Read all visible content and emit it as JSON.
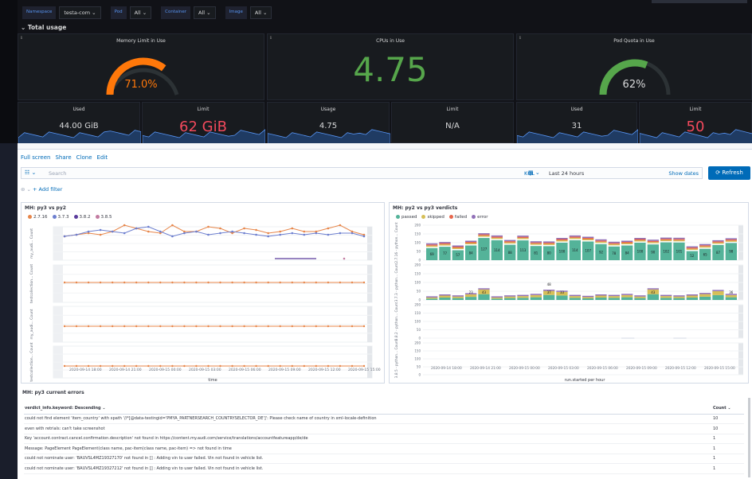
{
  "grafana": {
    "filters": [
      {
        "label": "Namespace",
        "value": "testa-com ⌄"
      },
      {
        "label": "Pod",
        "value": "All ⌄"
      },
      {
        "label": "Container",
        "value": "All ⌄"
      },
      {
        "label": "Image",
        "value": "All ⌄"
      }
    ],
    "row_title": "⌄ Total usage",
    "panels": {
      "memory": {
        "title": "Memory Limit in Use",
        "value": "71.0%",
        "fraction": 0.71,
        "color": "#ff780a"
      },
      "cpus": {
        "title": "CPUs in Use",
        "value": "4.75",
        "color": "#56a64b"
      },
      "pod_quota": {
        "title": "Pod Quota in Use",
        "value": "62%",
        "fraction": 0.62,
        "color": "#56a64b"
      }
    },
    "stats": [
      {
        "title": "Used",
        "value": "44.00 GiB",
        "color": "#d8d9da"
      },
      {
        "title": "Limit",
        "value": "62 GiB",
        "color": "#f2495c"
      },
      {
        "title": "Usage",
        "value": "4.75",
        "color": "#d8d9da"
      },
      {
        "title": "Limit",
        "value": "N/A",
        "color": "#d8d9da"
      },
      {
        "title": "Used",
        "value": "31",
        "color": "#d8d9da"
      },
      {
        "title": "Limit",
        "value": "50",
        "color": "#f2495c"
      }
    ]
  },
  "kibana": {
    "links": [
      "Full screen",
      "Share",
      "Clone",
      "Edit"
    ],
    "search": {
      "placeholder": "Search",
      "kql": "KQL",
      "time": "Last 24 hours",
      "show_dates": "Show dates",
      "refresh": "⟳ Refresh"
    },
    "add_filter": "+ Add filter",
    "left_panel": {
      "title": "MH: py3 vs py2",
      "legend": [
        {
          "name": "2.7.16",
          "color": "#e7864a"
        },
        {
          "name": "3.7.3",
          "color": "#6d7fcf"
        },
        {
          "name": "3.8.2",
          "color": "#5a3b9c"
        },
        {
          "name": "3.8.5",
          "color": "#c27ba0"
        }
      ],
      "row_labels": [
        "my_audi... Count",
        "testcollection... Count",
        "my_audi... Count",
        "testcollection... Count"
      ],
      "x_ticks": [
        "2020-09-14 18:00",
        "2020-09-14 21:00",
        "2020-09-15 00:00",
        "2020-09-15 03:00",
        "2020-09-15 06:00",
        "2020-09-15 09:00",
        "2020-09-15 12:00",
        "2020-09-15 15:00"
      ],
      "x_label": "time"
    },
    "right_panel": {
      "title": "MH: py2 vs py3 verdicts",
      "legend": [
        {
          "name": "passed",
          "color": "#54b399"
        },
        {
          "name": "skipped",
          "color": "#d6bf57"
        },
        {
          "name": "failed",
          "color": "#e7664c"
        },
        {
          "name": "error",
          "color": "#9170b8"
        }
      ],
      "row_labels": [
        "2.7.16 - python... Count",
        "3.7.3 - python... Count",
        "3.8.2 - python... Count",
        "3.8.5 - python... Count"
      ],
      "y_ticks": [
        "200",
        "150",
        "100",
        "50",
        "0"
      ],
      "row1_values": [
        "69",
        "77",
        "57",
        "84",
        "127",
        "114",
        "88",
        "113",
        "81",
        "80",
        "100",
        "114",
        "107",
        "92",
        "78",
        "84",
        "100",
        "90",
        "102",
        "101",
        "52",
        "65",
        "87",
        "98"
      ],
      "row2_labels": [
        {
          "index": 3,
          "text": "23"
        },
        {
          "index": 4,
          "text": "43"
        },
        {
          "index": 9,
          "text": "48"
        },
        {
          "index": 9,
          "text": "37"
        },
        {
          "index": 10,
          "text": "33"
        },
        {
          "index": 17,
          "text": "43"
        },
        {
          "index": 23,
          "text": "36"
        }
      ],
      "x_ticks": [
        "2020-09-14 18:00",
        "2020-09-14 21:00",
        "2020-09-15 00:00",
        "2020-09-15 03:00",
        "2020-09-15 06:00",
        "2020-09-15 09:00",
        "2020-09-15 12:00",
        "2020-09-15 15:00"
      ],
      "x_label": "run.started per hour"
    },
    "errors": {
      "title": "MH: py3 current errors",
      "col_verdict": "verdict_info.keyword: Descending ⌄",
      "col_count": "Count ⌄",
      "rows": [
        {
          "text": "could not find element 'item_country' with xpath '//*[@data-testingid='PMYA_PARTNERSEARCH_COUNTRYSELECTOR_DE']': Please check name of country in xml-locale-definition",
          "count": "10"
        },
        {
          "text": "even with retrials: can't take screenshot",
          "count": "10"
        },
        {
          "text": "Key 'account.contract.cancel.confirmation.description' not found in https://content.my.audi.com/service/translations/accountfeatureapp/de/de",
          "count": "1"
        },
        {
          "text": "Message: PageElement PageElement(class name, pac-item(class name, pac-item) => not found in time",
          "count": "1"
        },
        {
          "text": "could not nominate user: 'BAUVSL4MZ19327170' not found in [] : Adding vin to user failed. Vin not found in vehicle list.",
          "count": "1"
        },
        {
          "text": "could not nominate user: 'BAUVSL4MZ19327212' not found in [] : Adding vin to user failed. Vin not found in vehicle list.",
          "count": "1"
        }
      ]
    }
  }
}
